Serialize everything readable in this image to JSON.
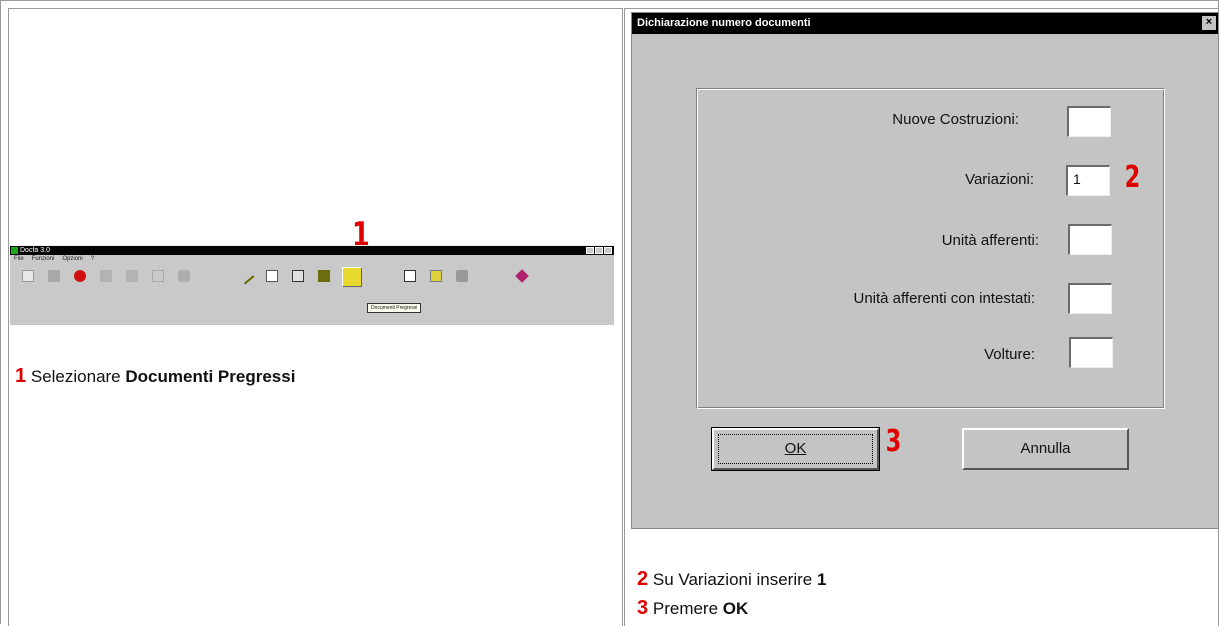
{
  "left": {
    "step_number": "1",
    "toolbar_window": {
      "title": "Docfa 3.0",
      "menu": [
        "File",
        "Funzioni",
        "Opzioni",
        "?"
      ],
      "tooltip": "Documenti Pregressi"
    },
    "instruction": {
      "num": "1",
      "prefix": "Selezionare",
      "bold": "Documenti Pregressi"
    }
  },
  "dialog": {
    "title": "Dichiarazione numero documenti",
    "close_glyph": "×",
    "fields": [
      {
        "label": "Nuove Costruzioni:",
        "value": ""
      },
      {
        "label": "Variazioni:",
        "value": "1"
      },
      {
        "label": "Unità afferenti:",
        "value": ""
      },
      {
        "label": "Unità afferenti con intestati:",
        "value": ""
      },
      {
        "label": "Volture:",
        "value": ""
      }
    ],
    "ok_label": "OK",
    "cancel_label": "Annulla",
    "step2_number": "2",
    "step3_number": "3"
  },
  "notes": [
    {
      "num": "2",
      "prefix": "Su Variazioni inserire",
      "bold": "1"
    },
    {
      "num": "3",
      "prefix": "Premere",
      "bold": "OK"
    }
  ],
  "colors": {
    "step_red": "#e10000",
    "dialog_gray": "#c4c4c4",
    "titlebar": "#000000"
  }
}
